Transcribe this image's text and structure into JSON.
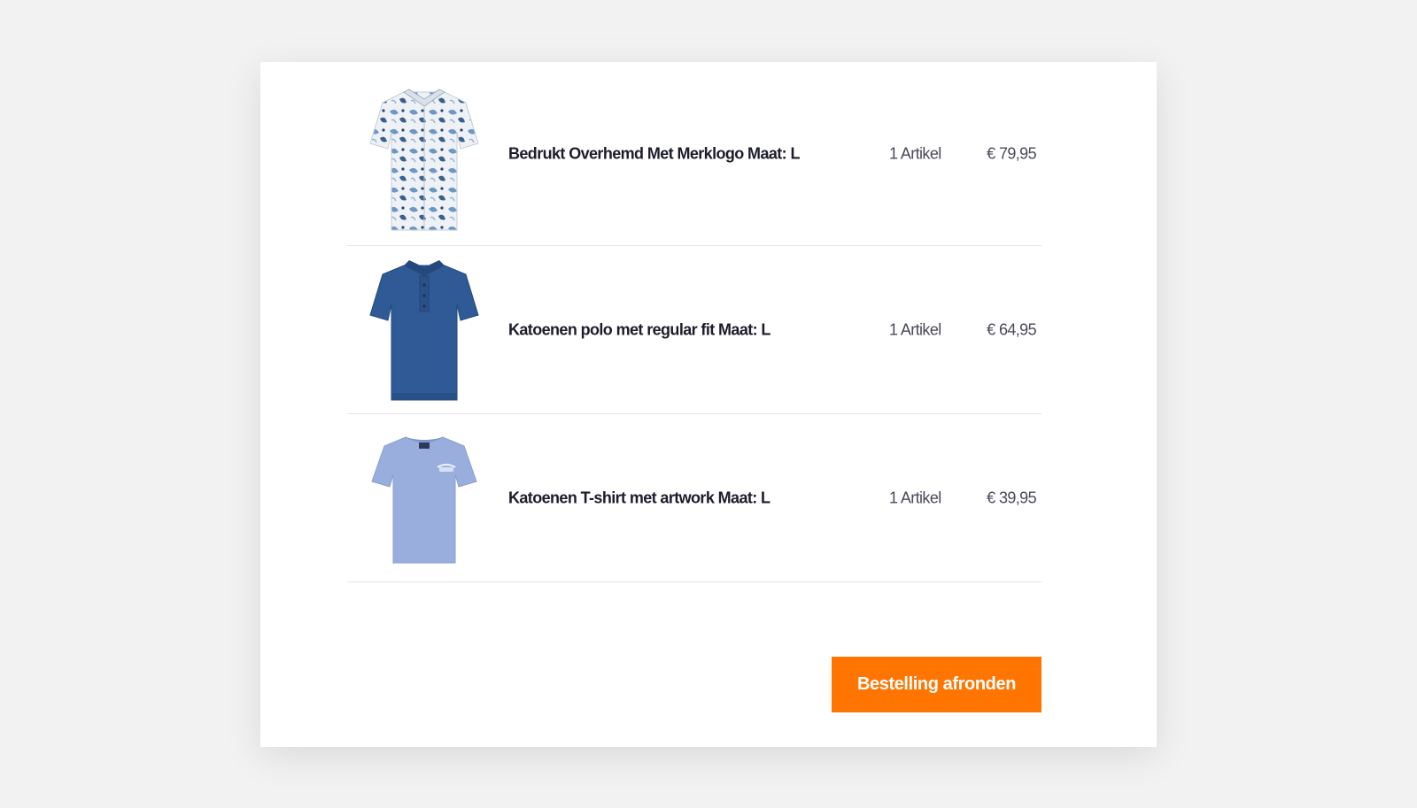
{
  "cart": {
    "items": [
      {
        "name": "Bedrukt Overhemd Met Merklogo Maat: L",
        "quantity": "1 Artikel",
        "price": "€ 79,95",
        "image_icon": "printed-shirt-icon",
        "color": "#e9eef3"
      },
      {
        "name": "Katoenen polo met regular fit Maat: L",
        "quantity": "1 Artikel",
        "price": "€ 64,95",
        "image_icon": "polo-shirt-icon",
        "color": "#2f5a95"
      },
      {
        "name": "Katoenen T-shirt met artwork Maat: L",
        "quantity": "1 Artikel",
        "price": "€ 39,95",
        "image_icon": "t-shirt-icon",
        "color": "#9aaede"
      }
    ]
  },
  "checkout": {
    "label": "Bestelling afronden",
    "color": "#ff7500"
  }
}
